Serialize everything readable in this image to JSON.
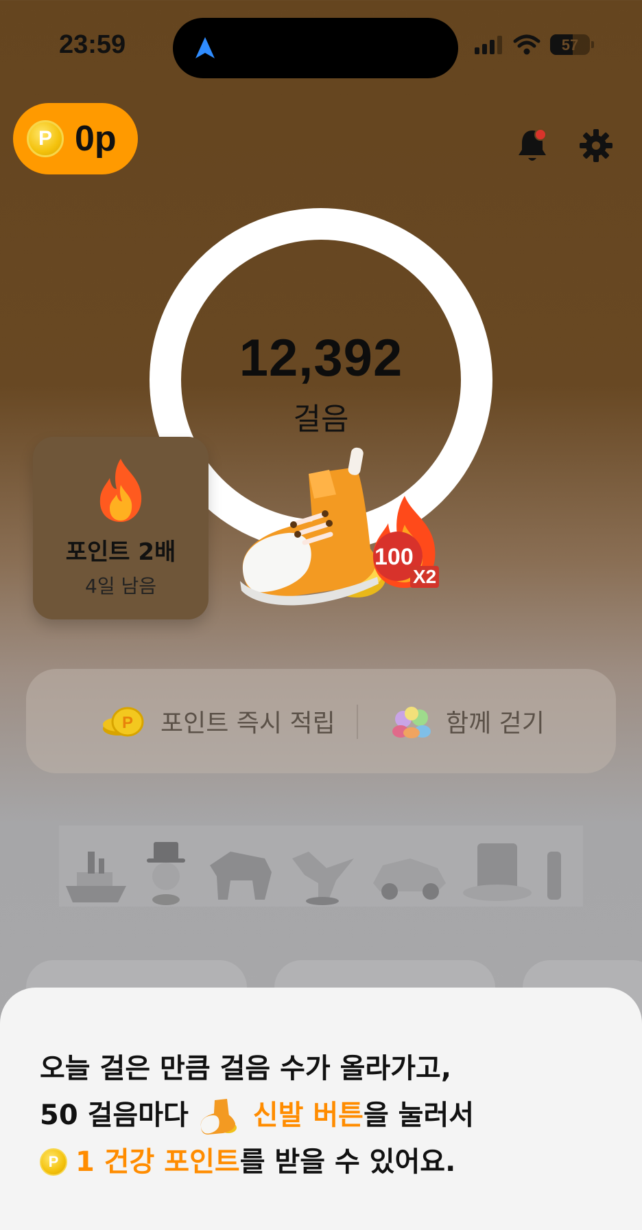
{
  "status_bar": {
    "time": "23:59",
    "battery": "57",
    "battery_level": 0.57
  },
  "header": {
    "points": "0p",
    "coin_symbol": "P"
  },
  "steps": {
    "count": "12,392",
    "unit": "걸음"
  },
  "double_points_card": {
    "title": "포인트 2배",
    "subtitle": "4일 남음"
  },
  "shoe_button": {
    "bonus_value": "100",
    "multiplier": "X2"
  },
  "actions": [
    {
      "label": "포인트 즉시 적립",
      "icon": "coin-stack-icon"
    },
    {
      "label": "함께 걷기",
      "icon": "group-icon"
    }
  ],
  "tokens": [
    "ship-token",
    "man-token",
    "dog-token",
    "dinosaur-token",
    "car-token",
    "hat-token"
  ],
  "sheet": {
    "line1": "오늘 걸은 만큼 걸음 수가 올라가고,",
    "line2_prefix": "50 걸음마다",
    "line2_accent": "신발 버튼",
    "line2_suffix": "을 눌러서",
    "line3_accent": "1 건강 포인트",
    "line3_suffix": "를 받을 수 있어요."
  },
  "colors": {
    "accent": "#ff8c00",
    "pill": "#ff9a00",
    "background_top": "#65451f"
  }
}
